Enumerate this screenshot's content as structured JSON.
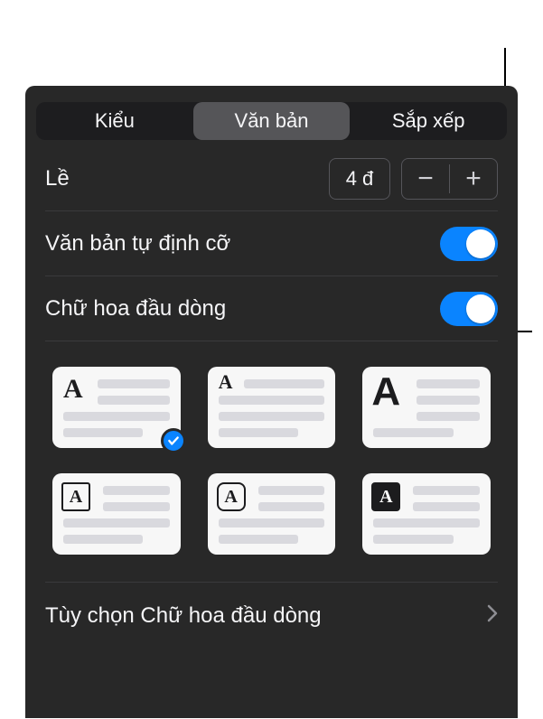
{
  "tabs": {
    "style": "Kiểu",
    "text": "Văn bản",
    "arrange": "Sắp xếp"
  },
  "margin": {
    "label": "Lề",
    "value": "4 đ"
  },
  "autofit": {
    "label": "Văn bản tự định cỡ",
    "on": true
  },
  "dropcap": {
    "label": "Chữ hoa đầu dòng",
    "on": true
  },
  "styles": {
    "selected": 0
  },
  "options": {
    "label": "Tùy chọn Chữ hoa đầu dòng"
  }
}
